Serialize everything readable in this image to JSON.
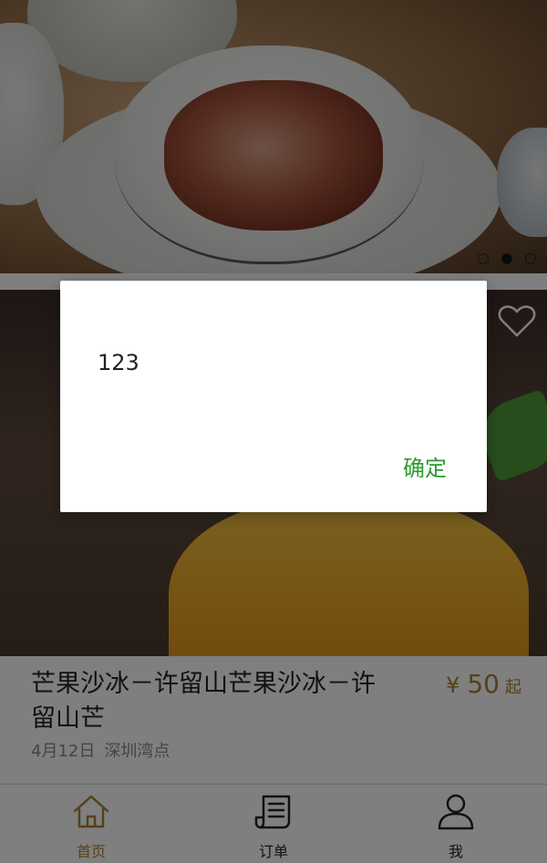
{
  "banner": {
    "carousel_dots": [
      "inactive",
      "active",
      "inactive"
    ]
  },
  "card": {
    "title": "芒果沙冰－许留山芒果沙冰－许留山芒",
    "price": {
      "currency": "¥",
      "amount": "50",
      "suffix": "起",
      "color": "#a9822f"
    },
    "date": "4月12日",
    "location": "深圳湾点",
    "favorite_icon": "heart-outline-icon"
  },
  "tabbar": {
    "items": [
      {
        "label": "首页",
        "icon": "home-icon",
        "active": true
      },
      {
        "label": "订单",
        "icon": "order-list-icon",
        "active": false
      },
      {
        "label": "我",
        "icon": "user-icon",
        "active": false
      }
    ],
    "active_color": "#a9822f"
  },
  "dialog": {
    "message": "123",
    "confirm_label": "确定",
    "confirm_color": "#2e9a2e"
  }
}
